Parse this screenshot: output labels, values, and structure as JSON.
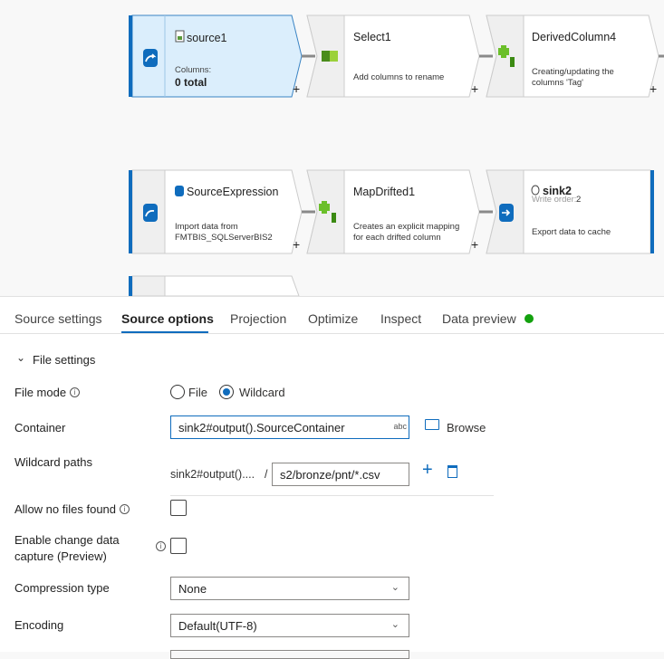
{
  "nodes": [
    {
      "title": "source1",
      "label": "Columns:",
      "value": "0 total"
    },
    {
      "title": "Select1",
      "desc": "Add columns to rename"
    },
    {
      "title": "DerivedColumn4",
      "desc": "Creating/updating the columns 'Tag'"
    },
    {
      "title": "SourceExpression",
      "desc": "Import data from FMTBIS_SQLServerBIS2"
    },
    {
      "title": "MapDrifted1",
      "desc": "Creates an explicit mapping for each drifted column"
    },
    {
      "title": "sink2",
      "write_order_label": "Write order:",
      "write_order": "2",
      "desc": "Export data to cache"
    }
  ],
  "plus": "+",
  "tabs": [
    "Source settings",
    "Source options",
    "Projection",
    "Optimize",
    "Inspect",
    "Data preview"
  ],
  "active_tab": "Source options",
  "status_color": "#13a10e",
  "section": "File settings",
  "form": {
    "file_mode_label": "File mode",
    "file_mode_options": [
      "File",
      "Wildcard"
    ],
    "file_mode_selected": "Wildcard",
    "container_label": "Container",
    "container_value": "sink2#output().SourceContainer",
    "container_badge": "abc",
    "browse": "Browse",
    "wildcard_label": "Wildcard paths",
    "wildcard_prefix": "sink2#output()....",
    "wildcard_sep": "/",
    "wildcard_value": "s2/bronze/pnt/*.csv",
    "allow_no_files_label": "Allow no files found",
    "cdc_label": "Enable change data capture (Preview)",
    "compression_label": "Compression type",
    "compression_value": "None",
    "encoding_label": "Encoding",
    "encoding_value": "Default(UTF-8)"
  },
  "info_glyph": "i"
}
